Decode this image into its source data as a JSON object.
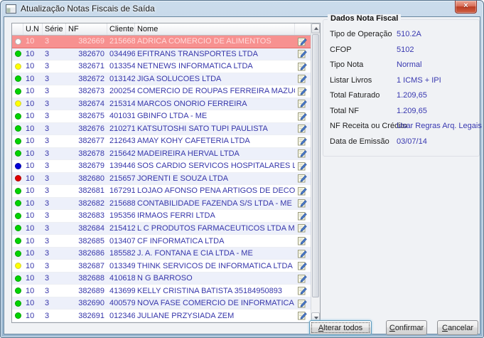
{
  "window": {
    "title": "Atualização Notas Fiscais de Saída"
  },
  "icons": {
    "close": "×"
  },
  "table": {
    "headers": {
      "un": "U.N",
      "serie": "Série",
      "nf": "NF",
      "cliente": "Cliente",
      "nome": "Nome"
    },
    "rows": [
      {
        "status": "white",
        "un": "10",
        "serie": "3",
        "nf": "382669",
        "cliente": "215668",
        "nome": "ADRICA COMERCIO DE ALIMENTOS",
        "selected": true
      },
      {
        "status": "green",
        "un": "10",
        "serie": "3",
        "nf": "382670",
        "cliente": "034496",
        "nome": "EFITRANS TRANSPORTES LTDA"
      },
      {
        "status": "yellow",
        "un": "10",
        "serie": "3",
        "nf": "382671",
        "cliente": "013354",
        "nome": "NETNEWS INFORMATICA LTDA"
      },
      {
        "status": "green",
        "un": "10",
        "serie": "3",
        "nf": "382672",
        "cliente": "013142",
        "nome": "JIGA SOLUCOES LTDA"
      },
      {
        "status": "green",
        "un": "10",
        "serie": "3",
        "nf": "382673",
        "cliente": "200254",
        "nome": "COMERCIO DE ROUPAS FERREIRA MAZUCHINI LTDA M"
      },
      {
        "status": "yellow",
        "un": "10",
        "serie": "3",
        "nf": "382674",
        "cliente": "215314",
        "nome": "MARCOS ONORIO FERREIRA"
      },
      {
        "status": "green",
        "un": "10",
        "serie": "3",
        "nf": "382675",
        "cliente": "401031",
        "nome": "GBINFO LTDA - ME"
      },
      {
        "status": "green",
        "un": "10",
        "serie": "3",
        "nf": "382676",
        "cliente": "210271",
        "nome": "KATSUTOSHI SATO TUPI PAULISTA"
      },
      {
        "status": "green",
        "un": "10",
        "serie": "3",
        "nf": "382677",
        "cliente": "212643",
        "nome": "AMAY KOHY CAFETERIA LTDA"
      },
      {
        "status": "green",
        "un": "10",
        "serie": "3",
        "nf": "382678",
        "cliente": "215642",
        "nome": "MADEIREIRA HERVAL LTDA"
      },
      {
        "status": "blue",
        "un": "10",
        "serie": "3",
        "nf": "382679",
        "cliente": "139446",
        "nome": "SOS CARDIO SERVICOS HOSPITALARES LTDA"
      },
      {
        "status": "red",
        "un": "10",
        "serie": "3",
        "nf": "382680",
        "cliente": "215657",
        "nome": "JORENTI E SOUZA LTDA"
      },
      {
        "status": "green",
        "un": "10",
        "serie": "3",
        "nf": "382681",
        "cliente": "167291",
        "nome": "LOJAO AFONSO PENA ARTIGOS DE DECORACOES LTDA"
      },
      {
        "status": "green",
        "un": "10",
        "serie": "3",
        "nf": "382682",
        "cliente": "215688",
        "nome": "CONTABILIDADE FAZENDA S/S LTDA - ME"
      },
      {
        "status": "green",
        "un": "10",
        "serie": "3",
        "nf": "382683",
        "cliente": "195356",
        "nome": "IRMAOS FERRI LTDA"
      },
      {
        "status": "green",
        "un": "10",
        "serie": "3",
        "nf": "382684",
        "cliente": "215412",
        "nome": "L C PRODUTOS FARMACEUTICOS LTDA ME"
      },
      {
        "status": "green",
        "un": "10",
        "serie": "3",
        "nf": "382685",
        "cliente": "013407",
        "nome": "CF INFORMATICA LTDA"
      },
      {
        "status": "green",
        "un": "10",
        "serie": "3",
        "nf": "382686",
        "cliente": "185582",
        "nome": "J. A. FONTANA E CIA LTDA - ME"
      },
      {
        "status": "yellow",
        "un": "10",
        "serie": "3",
        "nf": "382687",
        "cliente": "013349",
        "nome": "THINK SERVICOS DE INFORMATICA LTDA"
      },
      {
        "status": "green",
        "un": "10",
        "serie": "3",
        "nf": "382688",
        "cliente": "410618",
        "nome": "N G BARROSO"
      },
      {
        "status": "green",
        "un": "10",
        "serie": "3",
        "nf": "382689",
        "cliente": "413699",
        "nome": "KELLY CRISTINA BATISTA 35184950893"
      },
      {
        "status": "green",
        "un": "10",
        "serie": "3",
        "nf": "382690",
        "cliente": "400579",
        "nome": "NOVA FASE COMERCIO DE INFORMATICA LTDA"
      },
      {
        "status": "green",
        "un": "10",
        "serie": "3",
        "nf": "382691",
        "cliente": "012346",
        "nome": "JULIANE PRZYSIADA ZEM"
      }
    ]
  },
  "panel": {
    "title": "Dados Nota Fiscal",
    "fields": [
      {
        "label": "Tipo de Operação",
        "value": "510.2A"
      },
      {
        "label": "CFOP",
        "value": "5102"
      },
      {
        "label": "Tipo Nota",
        "value": "Normal"
      },
      {
        "label": "Listar Livros",
        "value": "1 ICMS + IPI"
      },
      {
        "label": "Total Faturado",
        "value": "1.209,65"
      },
      {
        "label": "Total NF",
        "value": "1.209,65"
      },
      {
        "label": "NF Receita ou Crédito",
        "value": "Usar Regras Arq. Legais"
      },
      {
        "label": "Data de Emissão",
        "value": "03/07/14"
      }
    ]
  },
  "buttons": {
    "alterar_todos": {
      "accel": "A",
      "rest": "lterar todos"
    },
    "confirmar": {
      "accel": "C",
      "rest": "onfirmar"
    },
    "cancelar": {
      "accel": "C",
      "rest": "ancelar"
    }
  },
  "colors": {
    "status": {
      "green": "#00d400",
      "yellow": "#ffff00",
      "red": "#e10000",
      "blue": "#0000d8",
      "white": "#ffffff"
    },
    "selected_row_bg": "#f79190",
    "grid_text": "#3636aa",
    "value_text": "#3838b0"
  }
}
